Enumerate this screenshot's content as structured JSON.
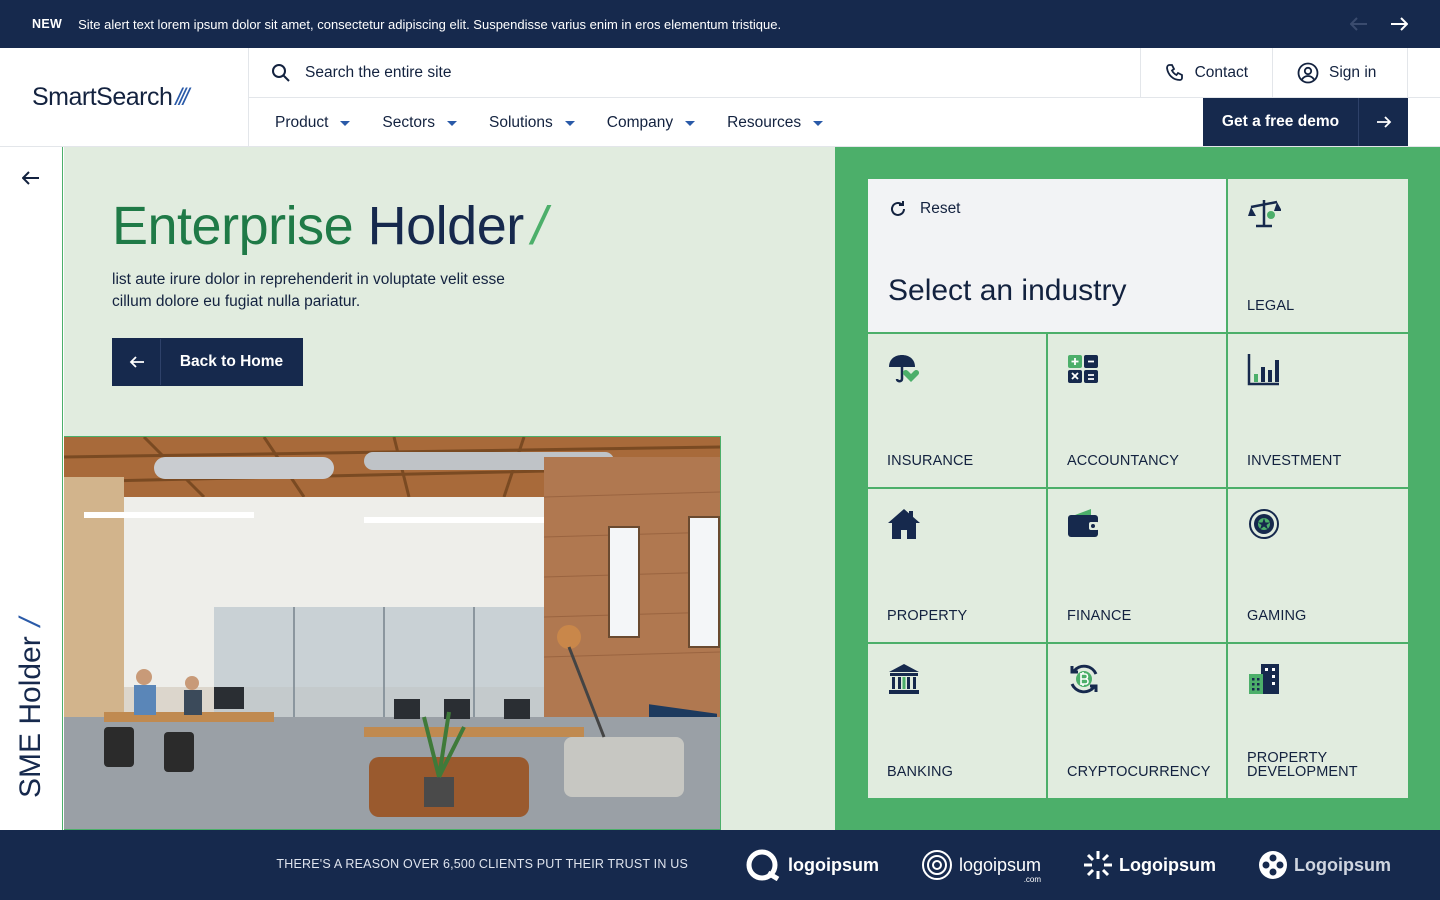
{
  "alert": {
    "tag": "NEW",
    "message": "Site alert text lorem ipsum dolor sit amet, consectetur adipiscing elit. Suspendisse varius enim in eros elementum tristique."
  },
  "header": {
    "logo_text": "SmartSearch",
    "logo_mark": "///",
    "search_placeholder": "Search the entire site",
    "contact_label": "Contact",
    "signin_label": "Sign in",
    "nav": [
      "Product",
      "Sectors",
      "Solutions",
      "Company",
      "Resources"
    ],
    "demo_label": "Get a free demo"
  },
  "rail": {
    "vertical_title": "SME Holder",
    "vertical_mark": "/"
  },
  "hero": {
    "title_part1": "Enterprise",
    "title_part2": "Holder",
    "title_mark": "/",
    "description": "list aute irure dolor in reprehenderit in voluptate velit esse cillum dolore eu fugiat nulla pariatur.",
    "back_label": "Back to Home"
  },
  "industry": {
    "reset_label": "Reset",
    "title": "Select an industry",
    "items": [
      {
        "label": "LEGAL",
        "icon": "scales-icon"
      },
      {
        "label": "INSURANCE",
        "icon": "umbrella-heart-icon"
      },
      {
        "label": "ACCOUNTANCY",
        "icon": "calculator-icon"
      },
      {
        "label": "INVESTMENT",
        "icon": "bar-chart-icon"
      },
      {
        "label": "PROPERTY",
        "icon": "house-icon"
      },
      {
        "label": "FINANCE",
        "icon": "wallet-icon"
      },
      {
        "label": "GAMING",
        "icon": "poker-chip-icon"
      },
      {
        "label": "BANKING",
        "icon": "bank-icon"
      },
      {
        "label": "CRYPTOCURRENCY",
        "icon": "bitcoin-icon"
      },
      {
        "label": "PROPERTY DEVELOPMENT",
        "icon": "buildings-icon"
      }
    ]
  },
  "trust": {
    "text": "THERE'S A REASON OVER 6,500 CLIENTS PUT THEIR TRUST IN US",
    "brands": [
      "logoipsum",
      "logoipsum",
      "Logoipsum",
      "Logoipsum"
    ],
    "brand2_sub": ".com"
  },
  "colors": {
    "navy": "#16294d",
    "green": "#4caf6a",
    "pale_green": "#e1ecdf",
    "dark_green": "#1f7a47",
    "blue_accent": "#2a5aa8"
  }
}
